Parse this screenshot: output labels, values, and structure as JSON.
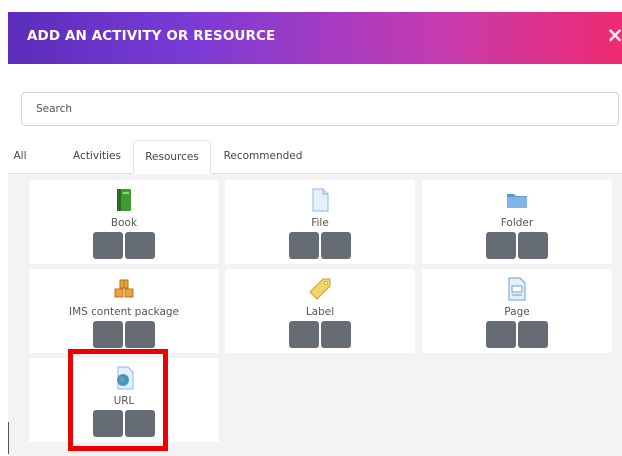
{
  "dialog": {
    "title": "ADD AN ACTIVITY OR RESOURCE",
    "close_icon": "close-icon",
    "close_glyph": "×"
  },
  "search": {
    "placeholder": "Search"
  },
  "tabs": [
    {
      "label": "All",
      "active": false
    },
    {
      "label": "Activities",
      "active": false
    },
    {
      "label": "Resources",
      "active": true
    },
    {
      "label": "Recommended",
      "active": false
    }
  ],
  "resources": [
    {
      "name": "Book",
      "icon": "book-icon"
    },
    {
      "name": "File",
      "icon": "file-icon"
    },
    {
      "name": "Folder",
      "icon": "folder-icon"
    },
    {
      "name": "IMS content package",
      "icon": "ims-package-icon"
    },
    {
      "name": "Label",
      "icon": "label-tag-icon"
    },
    {
      "name": "Page",
      "icon": "page-icon"
    },
    {
      "name": "URL",
      "icon": "url-globe-icon"
    }
  ],
  "colors": {
    "header_gradient_start": "#5b2dbb",
    "header_gradient_end": "#ef2b72",
    "card_button": "#666c73",
    "highlight_box": "#ee0000",
    "grid_background": "#f3f3f5"
  }
}
